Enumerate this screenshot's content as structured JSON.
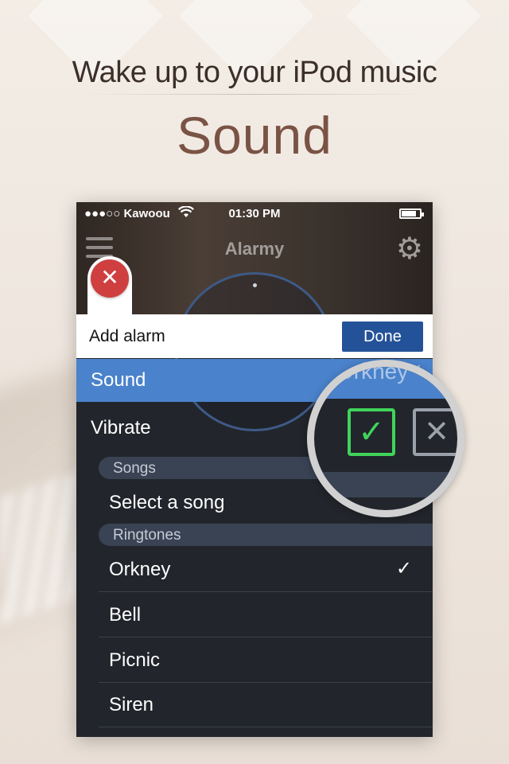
{
  "promo": {
    "tagline": "Wake up to your iPod music",
    "feature": "Sound"
  },
  "statusbar": {
    "carrier": "●●●○○ Kawoou",
    "time": "01:30 PM"
  },
  "app": {
    "title": "Alarmy"
  },
  "header": {
    "title": "Add alarm",
    "done_label": "Done"
  },
  "sound_row": {
    "label": "Sound",
    "value": "Orkney"
  },
  "vibrate_row": {
    "label": "Vibrate",
    "enabled": true
  },
  "sections": {
    "songs": {
      "title": "Songs",
      "items": [
        {
          "label": "Select a song"
        }
      ]
    },
    "ringtones": {
      "title": "Ringtones",
      "items": [
        {
          "label": "Orkney",
          "selected": true,
          "check": "✓"
        },
        {
          "label": "Bell"
        },
        {
          "label": "Picnic"
        },
        {
          "label": "Siren"
        }
      ]
    }
  },
  "colors": {
    "accent_blue": "#4a82cb",
    "done_blue": "#245298",
    "close_red": "#cf3f3f",
    "check_green": "#3fd45a",
    "list_bg": "#22252b"
  },
  "icons": {
    "menu": "menu-icon",
    "settings": "gear-icon",
    "close": "close-icon",
    "wifi": "wifi-icon",
    "battery": "battery-icon",
    "vibrate_on": "checkbox-checked-icon",
    "vibrate_off": "checkbox-x-icon"
  }
}
